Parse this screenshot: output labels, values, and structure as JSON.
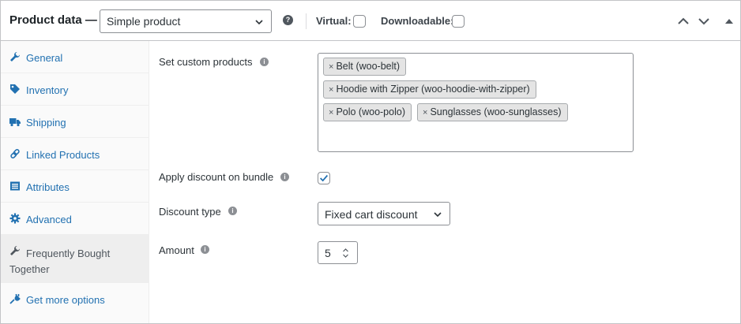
{
  "header": {
    "title": "Product data —",
    "product_type": "Simple product",
    "virtual_label": "Virtual:",
    "virtual_checked": false,
    "downloadable_label": "Downloadable:",
    "downloadable_checked": false,
    "icons": [
      "help-icon",
      "move-up-icon",
      "move-down-icon",
      "toggle-panel-icon"
    ]
  },
  "sidebar": {
    "tabs": [
      {
        "label": "General",
        "icon": "wrench-icon",
        "active": false
      },
      {
        "label": "Inventory",
        "icon": "tag-icon",
        "active": false
      },
      {
        "label": "Shipping",
        "icon": "truck-icon",
        "active": false
      },
      {
        "label": "Linked Products",
        "icon": "link-icon",
        "active": false
      },
      {
        "label": "Attributes",
        "icon": "table-icon",
        "active": false
      },
      {
        "label": "Advanced",
        "icon": "gear-icon",
        "active": false
      },
      {
        "label": "Frequently Bought Together",
        "icon": "wrench-icon",
        "active": true
      },
      {
        "label": "Get more options",
        "icon": "plug-icon",
        "active": false
      }
    ]
  },
  "fields": {
    "custom_products": {
      "label": "Set custom products",
      "items": [
        "Belt (woo-belt)",
        "Hoodie with Zipper (woo-hoodie-with-zipper)",
        "Polo (woo-polo)",
        "Sunglasses (woo-sunglasses)"
      ]
    },
    "apply_discount": {
      "label": "Apply discount on bundle",
      "checked": true
    },
    "discount_type": {
      "label": "Discount type",
      "value": "Fixed cart discount"
    },
    "amount": {
      "label": "Amount",
      "value": "5"
    }
  },
  "colors": {
    "link": "#2271b1",
    "active_tab_bg": "#eeeeee",
    "border": "#c3c4c7"
  }
}
